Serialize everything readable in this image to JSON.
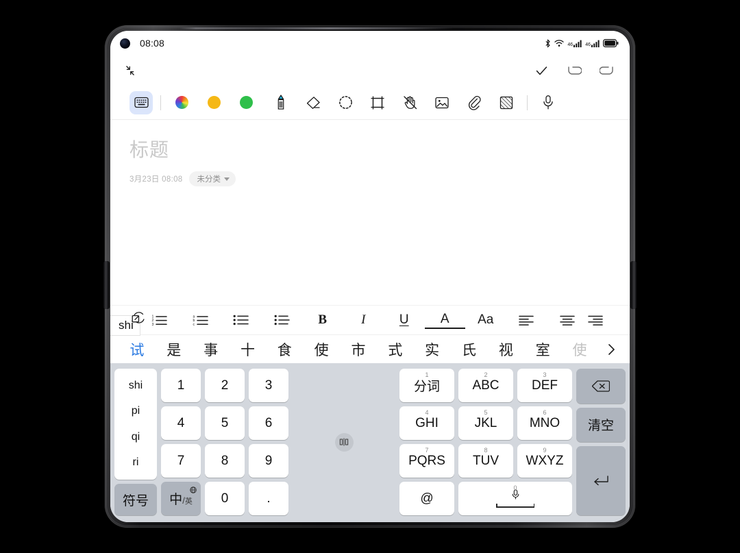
{
  "status_bar": {
    "clock": "08:08",
    "icons": [
      "bluetooth-icon",
      "wifi-icon",
      "signal-icon-1",
      "signal-icon-2",
      "battery-icon"
    ],
    "network_label_1": "46",
    "network_label_2": "46"
  },
  "app_header": {
    "collapse_icon": "collapse-arrows-icon",
    "actions": [
      {
        "name": "confirm-button",
        "icon": "checkmark-icon"
      },
      {
        "name": "undo-button",
        "icon": "undo-arrow-icon"
      },
      {
        "name": "redo-button",
        "icon": "redo-arrow-icon"
      }
    ]
  },
  "toolstrip": {
    "keyboard_tool": "keyboard-icon",
    "colors": [
      {
        "name": "color-picker-rainbow",
        "hex": "#multi"
      },
      {
        "name": "color-swatch-yellow",
        "hex": "#f5b816"
      },
      {
        "name": "color-swatch-green",
        "hex": "#2fbf4a"
      }
    ],
    "tools": [
      {
        "name": "pen-tool",
        "icon": "pen-icon"
      },
      {
        "name": "eraser-tool",
        "icon": "eraser-icon"
      },
      {
        "name": "lasso-select-tool",
        "icon": "dashed-circle-icon"
      },
      {
        "name": "crop-tool",
        "icon": "crop-frame-icon"
      },
      {
        "name": "palm-reject-tool",
        "icon": "hand-slash-icon"
      },
      {
        "name": "insert-image-tool",
        "icon": "image-icon"
      },
      {
        "name": "attachment-tool",
        "icon": "paperclip-icon"
      },
      {
        "name": "template-tool",
        "icon": "hatched-square-icon"
      },
      {
        "name": "voice-record-tool",
        "icon": "microphone-icon"
      }
    ]
  },
  "note": {
    "title_placeholder": "标题",
    "date": "3月23日 08:08",
    "category": "未分类"
  },
  "format_bar": {
    "compose_text": "shi",
    "compose_badge_icon": "edit-expand-icon",
    "items": [
      {
        "name": "numbered-list-button",
        "icon": "list-numbered-icon"
      },
      {
        "name": "lettered-list-button",
        "icon": "list-lettered-icon"
      },
      {
        "name": "bulleted-list-button",
        "icon": "list-bullet-icon"
      },
      {
        "name": "checklist-button",
        "icon": "list-dash-icon"
      },
      {
        "name": "bold-button",
        "label": "B"
      },
      {
        "name": "italic-button",
        "label": "I"
      },
      {
        "name": "underline-button",
        "label": "U"
      },
      {
        "name": "text-color-button",
        "label": "A"
      },
      {
        "name": "font-size-button",
        "label": "Aa"
      },
      {
        "name": "align-left-button",
        "icon": "align-left-icon"
      },
      {
        "name": "align-center-button",
        "icon": "align-center-icon"
      },
      {
        "name": "align-right-button",
        "icon": "align-right-icon"
      }
    ]
  },
  "candidates": {
    "list": [
      {
        "text": "试",
        "state": "active"
      },
      {
        "text": "是",
        "state": "normal"
      },
      {
        "text": "事",
        "state": "normal"
      },
      {
        "text": "十",
        "state": "normal"
      },
      {
        "text": "食",
        "state": "normal"
      },
      {
        "text": "使",
        "state": "normal"
      },
      {
        "text": "市",
        "state": "normal"
      },
      {
        "text": "式",
        "state": "normal"
      },
      {
        "text": "实",
        "state": "normal"
      },
      {
        "text": "氏",
        "state": "normal"
      },
      {
        "text": "视",
        "state": "normal"
      },
      {
        "text": "室",
        "state": "normal"
      },
      {
        "text": "使",
        "state": "dim"
      }
    ],
    "expand_icon": "chevron-right-icon"
  },
  "keyboard": {
    "pinyin_options": [
      "shi",
      "pi",
      "qi",
      "ri"
    ],
    "symbol_key": "符号",
    "lang_key": {
      "primary": "中",
      "separator": "/",
      "secondary": "英",
      "badge": "globe-icon"
    },
    "numeric_keys": [
      "1",
      "2",
      "3",
      "4",
      "5",
      "6",
      "7",
      "8",
      "9",
      "0",
      "."
    ],
    "split_handle_icon": "split-resize-icon",
    "t9_keys": [
      {
        "sup": "1",
        "main": "分词"
      },
      {
        "sup": "2",
        "main": "ABC"
      },
      {
        "sup": "3",
        "main": "DEF"
      },
      {
        "sup": "4",
        "main": "GHI"
      },
      {
        "sup": "5",
        "main": "JKL"
      },
      {
        "sup": "6",
        "main": "MNO"
      },
      {
        "sup": "7",
        "main": "PQRS"
      },
      {
        "sup": "8",
        "main": "TUV"
      },
      {
        "sup": "9",
        "main": "WXYZ"
      },
      {
        "sup": "",
        "main": "@"
      }
    ],
    "space_key": {
      "sup": "0",
      "icon": "microphone-icon"
    },
    "function_keys": [
      {
        "name": "backspace-key",
        "icon": "backspace-icon"
      },
      {
        "name": "clear-key",
        "label": "清空"
      },
      {
        "name": "enter-key",
        "icon": "enter-arrow-icon"
      }
    ]
  }
}
